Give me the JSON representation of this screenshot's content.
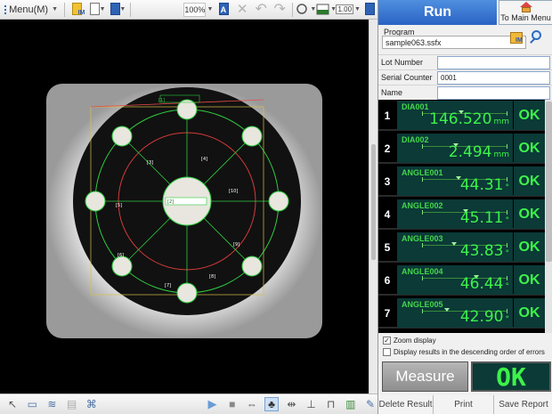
{
  "toolbar": {
    "menu_label": "Menu(M)",
    "zoom_value": "100%",
    "ratio_value": "1.00"
  },
  "measurement_overlay": {
    "labels": [
      "[1]",
      "[2]",
      "[3]",
      "[4]",
      "[5]",
      "[6]",
      "[7]",
      "[8]",
      "[9]",
      "[10]"
    ]
  },
  "panel": {
    "run_label": "Run",
    "main_menu_label": "To Main Menu",
    "program_label": "Program",
    "program_value": "sample063.ssfx",
    "info": [
      {
        "label": "Lot Number",
        "value": ""
      },
      {
        "label": "Serial Counter",
        "value": "0001"
      },
      {
        "label": "Name",
        "value": ""
      }
    ],
    "results": [
      {
        "index": "1",
        "name": "DIA001",
        "value": "146.520",
        "unit": "mm",
        "status": "OK",
        "position": 0.46
      },
      {
        "index": "2",
        "name": "DIA002",
        "value": "2.494",
        "unit": "mm",
        "status": "OK",
        "position": 0.4
      },
      {
        "index": "3",
        "name": "ANGLE001",
        "value": "44.31",
        "unit": "°",
        "status": "OK",
        "position": 0.43
      },
      {
        "index": "4",
        "name": "ANGLE002",
        "value": "45.11",
        "unit": "°",
        "status": "OK",
        "position": 0.51
      },
      {
        "index": "5",
        "name": "ANGLE003",
        "value": "43.83",
        "unit": "°",
        "status": "OK",
        "position": 0.38
      },
      {
        "index": "6",
        "name": "ANGLE004",
        "value": "46.44",
        "unit": "°",
        "status": "OK",
        "position": 0.64
      },
      {
        "index": "7",
        "name": "ANGLE005",
        "value": "42.90",
        "unit": "°",
        "status": "OK",
        "position": 0.29
      }
    ],
    "options": [
      {
        "label": "Zoom display",
        "checked": true
      },
      {
        "label": "Display results in the descending order of errors",
        "checked": false
      }
    ],
    "measure_label": "Measure",
    "total_result": "OK",
    "footer": [
      "Delete Result",
      "Print",
      "Save Report"
    ]
  },
  "colors": {
    "ok_green": "#3df24a",
    "result_bg": "#0b3a37",
    "run_blue": "#2a63c4"
  }
}
